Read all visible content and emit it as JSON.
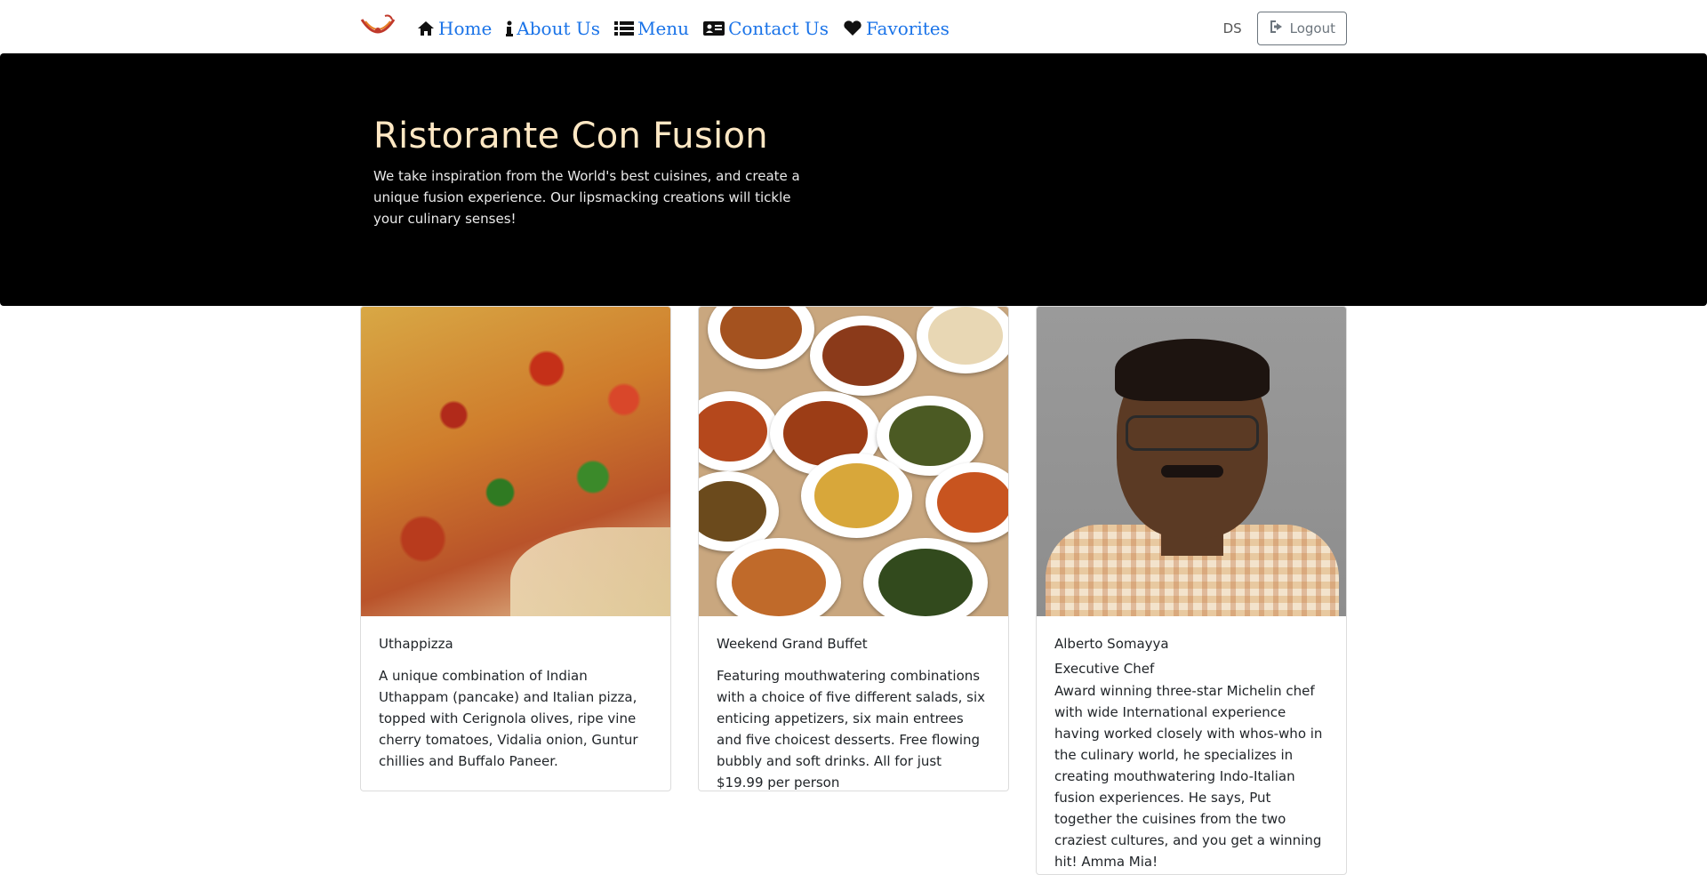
{
  "nav": {
    "logo_name": "ristorante-logo",
    "links": [
      {
        "label": "Home",
        "icon": "home-icon"
      },
      {
        "label": "About Us",
        "icon": "info-icon"
      },
      {
        "label": "Menu",
        "icon": "list-icon"
      },
      {
        "label": "Contact Us",
        "icon": "address-card-icon"
      },
      {
        "label": "Favorites",
        "icon": "heart-icon"
      }
    ],
    "user_initials": "DS",
    "logout_label": "Logout"
  },
  "jumbotron": {
    "title": "Ristorante Con Fusion",
    "text": "We take inspiration from the World's best cuisines, and create a unique fusion experience. Our lipsmacking creations will tickle your culinary senses!"
  },
  "cards": [
    {
      "title": "Uthappizza",
      "subtitle": "",
      "text": "A unique combination of Indian Uthappam (pancake) and Italian pizza, topped with Cerignola olives, ripe vine cherry tomatoes, Vidalia onion, Guntur chillies and Buffalo Paneer."
    },
    {
      "title": "Weekend Grand Buffet",
      "subtitle": "",
      "text": "Featuring mouthwatering combinations with a choice of five different salads, six enticing appetizers, six main entrees and five choicest desserts. Free flowing bubbly and soft drinks. All for just $19.99 per person"
    },
    {
      "title": "Alberto Somayya",
      "subtitle": "Executive Chef",
      "text": "Award winning three-star Michelin chef with wide International experience having worked closely with whos-who in the culinary world, he specializes in creating mouthwatering Indo-Italian fusion experiences. He says, Put together the cuisines from the two craziest cultures, and you get a winning hit! Amma Mia!"
    }
  ],
  "colors": {
    "link": "#1a73e8",
    "jumbotron_bg": "#000000",
    "jumbotron_title": "#ffe8c4"
  }
}
